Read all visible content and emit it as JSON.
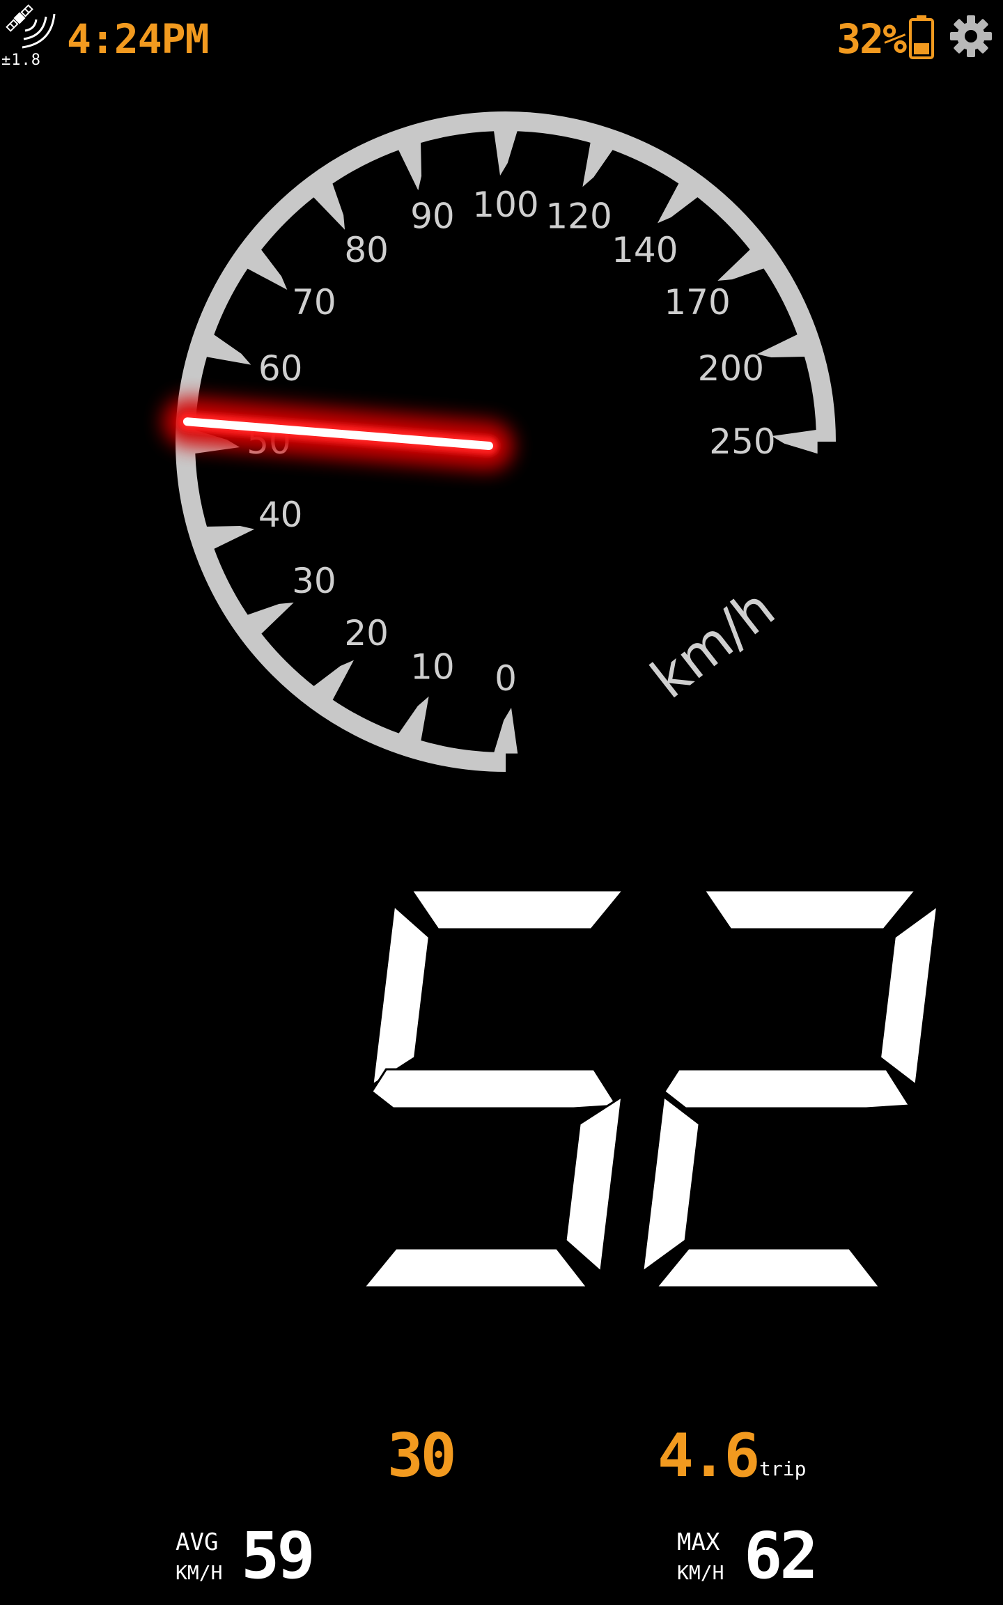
{
  "status_bar": {
    "gps_icon": "satellite-signal-icon",
    "gps_accuracy": "±1.8",
    "clock": "4:24PM",
    "battery_percent": "32%",
    "battery_icon": "battery-low-icon",
    "battery_level": 0.32,
    "settings_icon": "gear-icon"
  },
  "gauge": {
    "unit": "km/h",
    "current_speed": 52,
    "ticks": [
      "0",
      "10",
      "20",
      "30",
      "40",
      "50",
      "60",
      "70",
      "80",
      "90",
      "100",
      "120",
      "140",
      "170",
      "200",
      "250"
    ],
    "colors": {
      "dial": "#c8c8c8",
      "needle_glow": "#d40000",
      "needle_core": "#ffffff"
    }
  },
  "digital_speed": {
    "value": "52"
  },
  "trip": {
    "speed_limit": "30",
    "distance": "4.6",
    "distance_label": "trip"
  },
  "stats": {
    "avg_label": "AVG",
    "avg_unit": "KM/H",
    "avg_value": "59",
    "max_label": "MAX",
    "max_unit": "KM/H",
    "max_value": "62"
  },
  "colors": {
    "accent": "#f29a1f",
    "background": "#000000",
    "text": "#ffffff"
  }
}
